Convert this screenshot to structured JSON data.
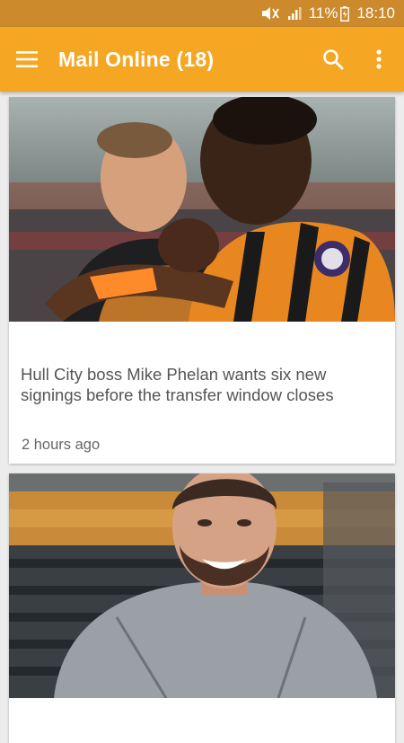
{
  "status_bar": {
    "battery": "11%",
    "time": "18:10"
  },
  "app_bar": {
    "title": "Mail Online (18)",
    "icons": [
      "menu-icon",
      "search-icon",
      "more-vert-icon"
    ]
  },
  "colors": {
    "primary": "#f5a623",
    "status_bar": "#cc8a2d"
  },
  "articles": [
    {
      "title": " Hull City boss Mike Phelan wants six new signings before the transfer window closes",
      "time": "2 hours ago",
      "image": "footballers-celebrating-photo"
    },
    {
      "image": "smiling-man-in-stadium-photo"
    }
  ]
}
